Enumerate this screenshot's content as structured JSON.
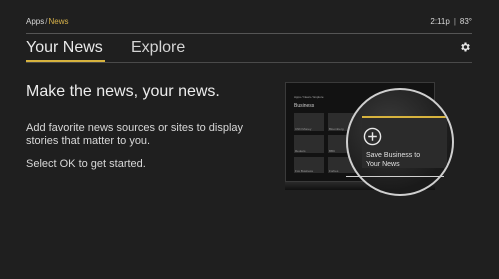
{
  "breadcrumb": {
    "parent": "Apps",
    "separator": "/",
    "current": "News"
  },
  "status": {
    "time": "2:11p",
    "separator": "|",
    "temperature": "83°"
  },
  "tabs": [
    {
      "label": "Your News",
      "selected": true
    },
    {
      "label": "Explore",
      "selected": false
    }
  ],
  "content": {
    "headline": "Make the news, your news.",
    "description": "Add favorite news sources or sites to display stories that matter to you.",
    "cta": "Select OK to get started."
  },
  "illustration": {
    "tv_section": "Business",
    "callout": "Save Business to Your News",
    "tv_header": "Apps / News / Explore",
    "tv_tile_labels": [
      "CNN Money",
      "Bloomberg",
      "Reuters",
      "BBC",
      "Fox Business",
      "Forbes"
    ]
  },
  "colors": {
    "accent": "#d7b33e",
    "background": "#1f1f1f",
    "text": "#e6e6e6"
  }
}
